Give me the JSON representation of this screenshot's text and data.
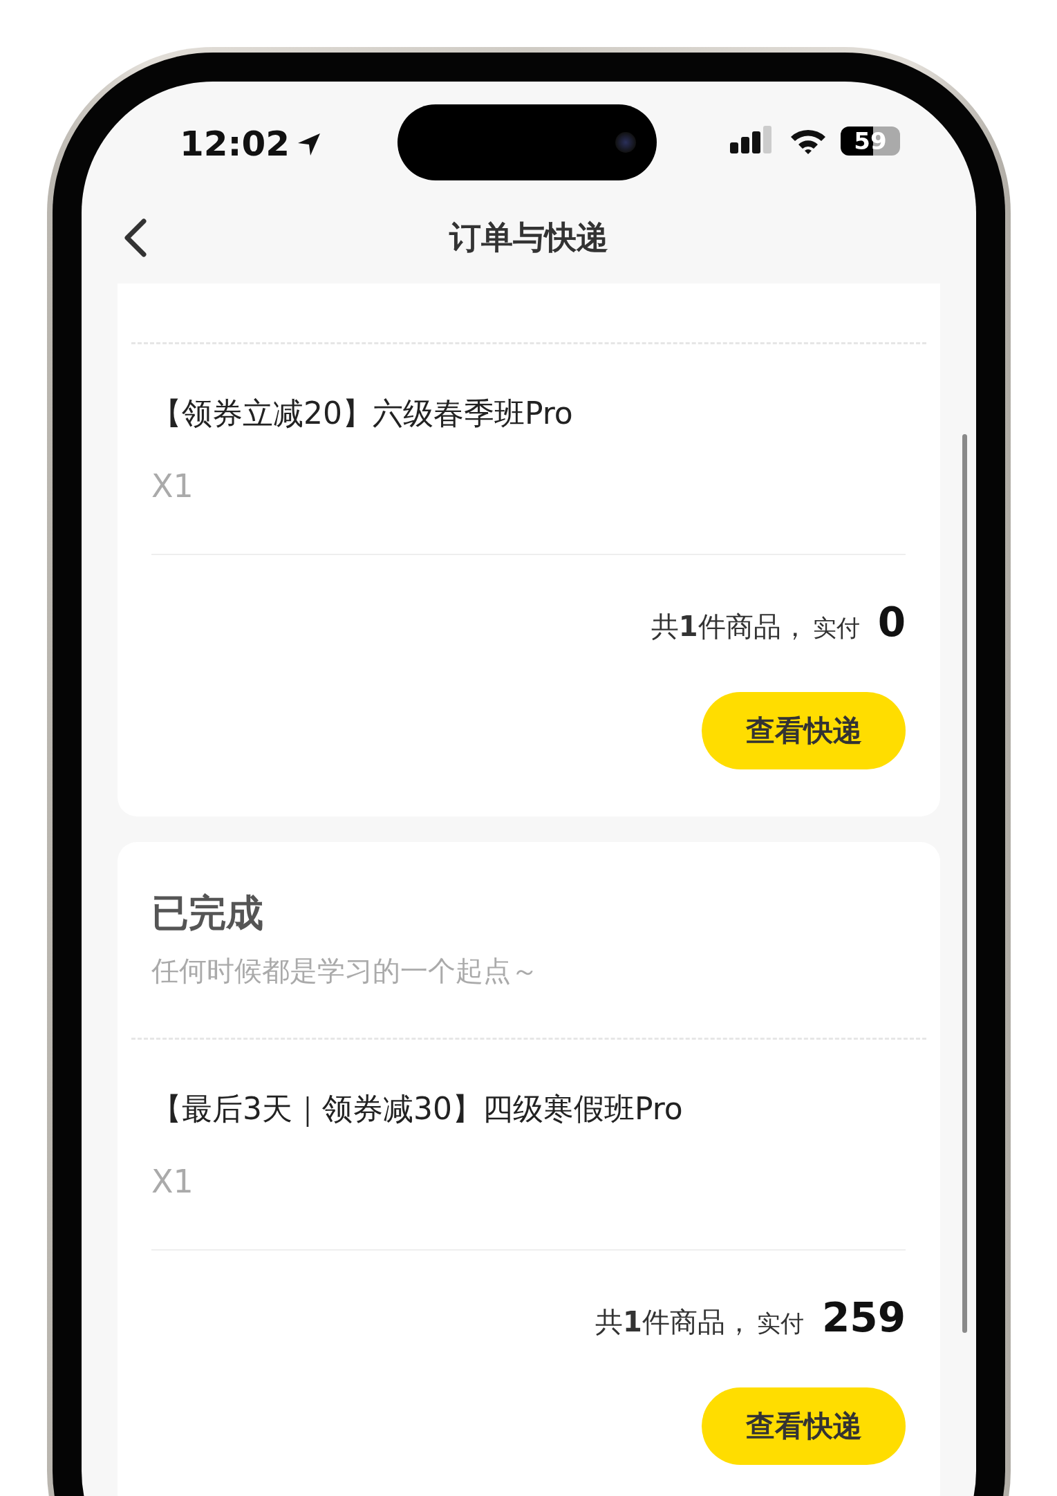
{
  "status_bar": {
    "time": "12:02",
    "battery": "59"
  },
  "nav": {
    "title": "订单与快递"
  },
  "orders": [
    {
      "items": [
        {
          "title": "【领券立减20】六级春季班Pro",
          "quantity": "X1"
        }
      ],
      "summary": "共**1**件商品，",
      "paid_label": "实付",
      "price": "0",
      "button": "查看快递"
    },
    {
      "status": "已完成",
      "subtitle": "任何时候都是学习的一个起点～",
      "items": [
        {
          "title": "【最后3天｜领券减30】四级寒假班Pro",
          "quantity": "X1"
        }
      ],
      "summary": "共**1**件商品，",
      "paid_label": "实付",
      "price": "259",
      "button": "查看快递"
    }
  ]
}
